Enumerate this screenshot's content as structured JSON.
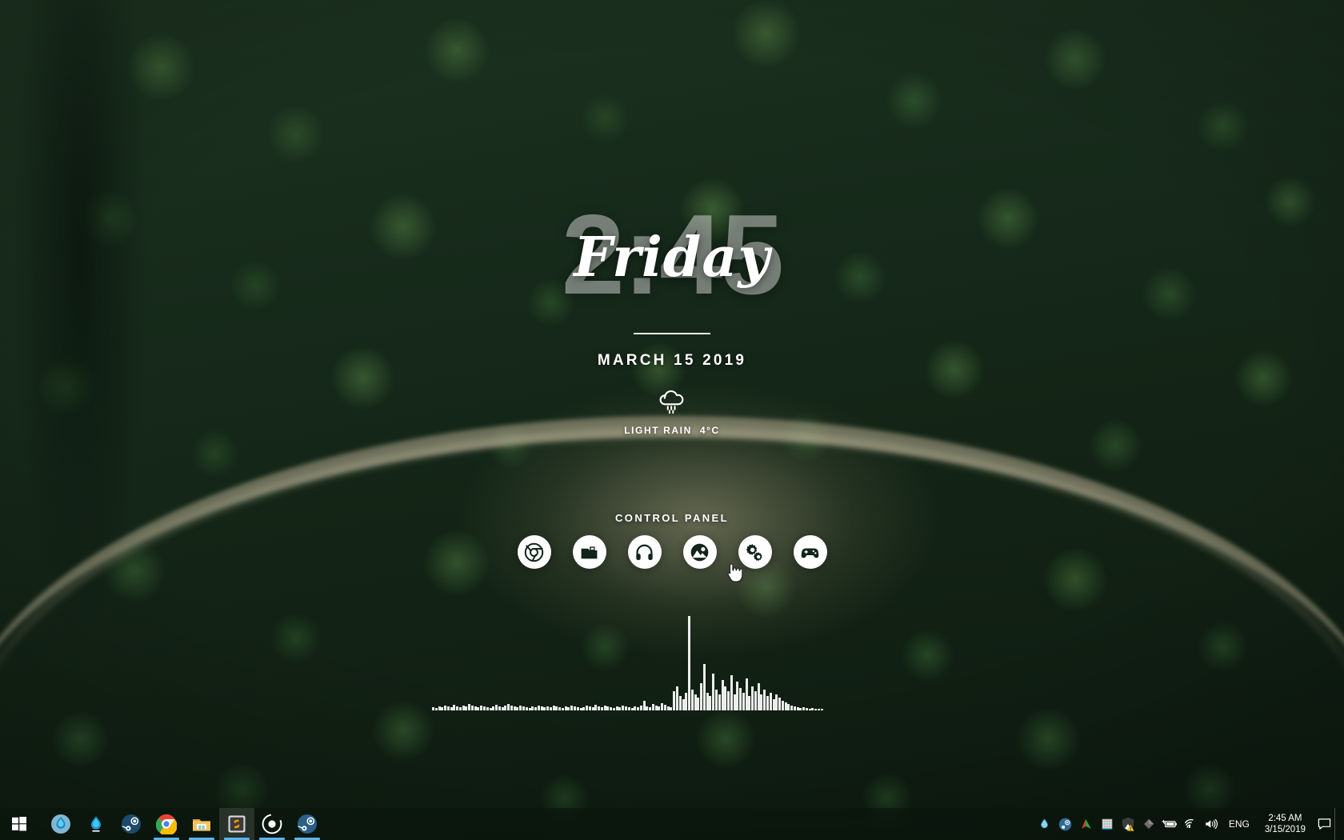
{
  "desktop": {
    "wallpaper_description": "aerial forest with dirt road",
    "accent_color": "#5fb2e8"
  },
  "clock_widget": {
    "time": "2:45",
    "day": "Friday",
    "date": "MARCH 15 2019"
  },
  "weather": {
    "icon": "rain-cloud-icon",
    "condition": "LIGHT RAIN",
    "temperature": "4°C"
  },
  "control_panel": {
    "title": "CONTROL PANEL",
    "icons": [
      {
        "name": "chrome-icon",
        "label": "Chrome"
      },
      {
        "name": "folder-icon",
        "label": "Files"
      },
      {
        "name": "headphones-icon",
        "label": "Music"
      },
      {
        "name": "photos-icon",
        "label": "Pictures"
      },
      {
        "name": "gears-icon",
        "label": "Settings"
      },
      {
        "name": "gamepad-icon",
        "label": "Games"
      }
    ]
  },
  "visualizer": {
    "bars": [
      4,
      3,
      5,
      4,
      6,
      5,
      4,
      7,
      5,
      4,
      6,
      5,
      8,
      6,
      5,
      4,
      6,
      5,
      4,
      3,
      5,
      7,
      5,
      4,
      6,
      8,
      6,
      5,
      4,
      6,
      5,
      4,
      3,
      5,
      4,
      6,
      5,
      4,
      5,
      4,
      6,
      5,
      4,
      3,
      5,
      4,
      6,
      5,
      4,
      3,
      4,
      6,
      5,
      4,
      7,
      5,
      4,
      6,
      5,
      4,
      3,
      5,
      4,
      6,
      5,
      4,
      3,
      5,
      4,
      6,
      12,
      5,
      4,
      8,
      6,
      5,
      9,
      7,
      5,
      4,
      24,
      30,
      18,
      14,
      22,
      118,
      26,
      20,
      16,
      34,
      58,
      22,
      18,
      46,
      26,
      20,
      38,
      30,
      24,
      44,
      20,
      36,
      28,
      22,
      40,
      18,
      30,
      24,
      34,
      20,
      26,
      18,
      22,
      14,
      20,
      16,
      12,
      10,
      8,
      6,
      5,
      4,
      3,
      4,
      3,
      2,
      3,
      2,
      2,
      2
    ],
    "max_height": 120,
    "color": "#ffffff"
  },
  "taskbar": {
    "start_button": "start-button",
    "apps": [
      {
        "name": "rainmeter-icon",
        "label": "Rainmeter",
        "open": false,
        "active": false
      },
      {
        "name": "waterdrop-icon",
        "label": "Water",
        "open": false,
        "active": false
      },
      {
        "name": "steam-icon",
        "label": "Steam",
        "open": false,
        "active": false
      },
      {
        "name": "chrome-icon",
        "label": "Google Chrome",
        "open": true,
        "active": false
      },
      {
        "name": "file-explorer-icon",
        "label": "File Explorer",
        "open": true,
        "active": false
      },
      {
        "name": "sublime-text-icon",
        "label": "Sublime Text",
        "open": true,
        "active": true
      },
      {
        "name": "circle-app-icon",
        "label": "Media Player",
        "open": true,
        "active": false
      },
      {
        "name": "steam-app-icon",
        "label": "Steam",
        "open": true,
        "active": false
      }
    ],
    "tray": [
      {
        "name": "waterdrop-tray-icon",
        "label": "Rainmeter"
      },
      {
        "name": "steam-tray-icon",
        "label": "Steam"
      },
      {
        "name": "triangle-tray-icon",
        "label": "Graphics"
      },
      {
        "name": "grid-tray-icon",
        "label": "Utility"
      },
      {
        "name": "security-shield-icon",
        "label": "Windows Security"
      },
      {
        "name": "diamond-tray-icon",
        "label": "App"
      },
      {
        "name": "battery-icon",
        "label": "Battery"
      },
      {
        "name": "wifi-icon",
        "label": "Network"
      },
      {
        "name": "volume-icon",
        "label": "Volume"
      }
    ],
    "language": "ENG",
    "clock": {
      "time": "2:45 AM",
      "date": "3/15/2019"
    },
    "action_center": "action-center-icon"
  }
}
